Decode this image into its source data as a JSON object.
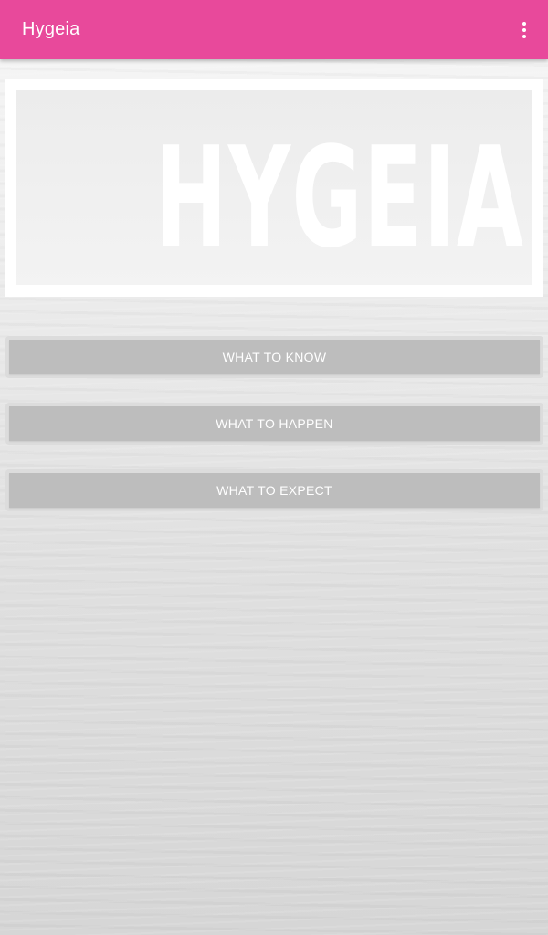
{
  "app_bar": {
    "title": "Hygeia",
    "menu_icon": "more-vert-icon",
    "color": "#e8499b"
  },
  "banner": {
    "logo_text": "HYGEIA"
  },
  "buttons": [
    {
      "label": "WHAT TO KNOW"
    },
    {
      "label": "WHAT TO HAPPEN"
    },
    {
      "label": "WHAT TO EXPECT"
    }
  ]
}
